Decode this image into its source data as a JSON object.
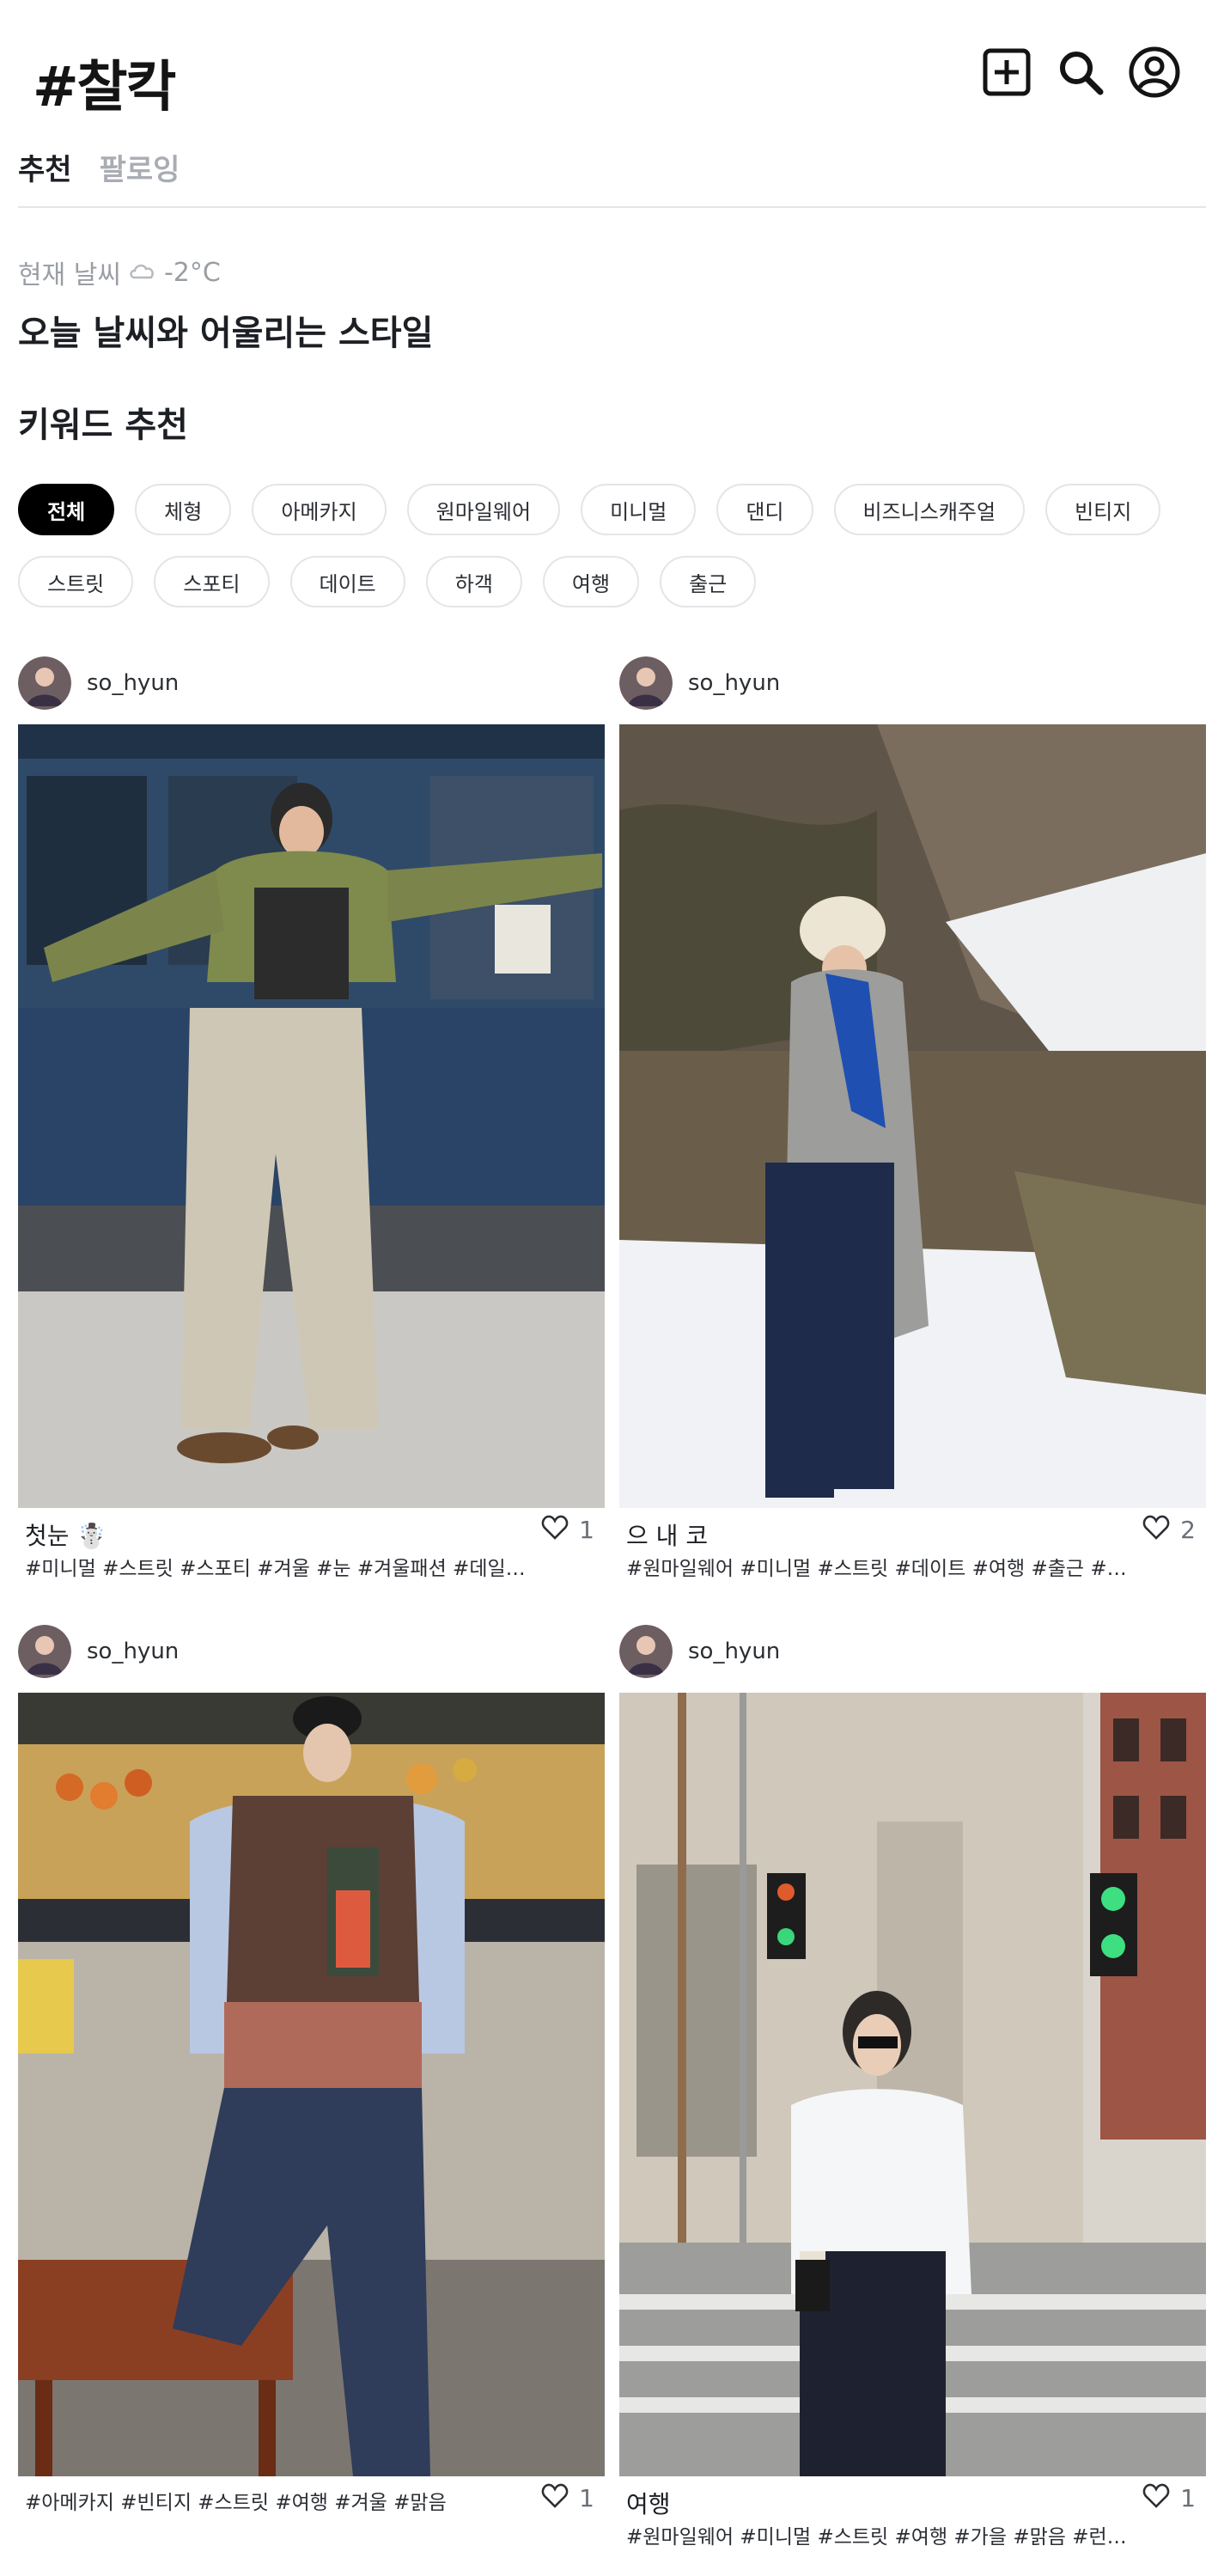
{
  "app": {
    "logo": "#찰칵"
  },
  "header": {
    "icons": [
      "add-square-icon",
      "search-icon",
      "profile-icon"
    ]
  },
  "tabs": [
    {
      "label": "추천",
      "active": true
    },
    {
      "label": "팔로잉",
      "active": false
    }
  ],
  "weather": {
    "label": "현재 날씨",
    "icon": "cloud-icon",
    "temp": "-2°C",
    "headline": "오늘 날씨와 어울리는 스타일"
  },
  "keywords": {
    "title": "키워드 추천",
    "row1": [
      "전체",
      "체형",
      "아메카지",
      "원마일웨어",
      "미니멀",
      "댄디",
      "비즈니스캐주얼",
      "빈티지"
    ],
    "row2": [
      "스트릿",
      "스포티",
      "데이트",
      "하객",
      "여행",
      "출근"
    ],
    "active": "전체"
  },
  "posts": [
    {
      "username": "so_hyun",
      "title": "첫눈 ☃️",
      "tags": "#미니멀 #스트릿 #스포티 #겨울 #눈 #겨울패션 #데일리...",
      "likes": "1"
    },
    {
      "username": "so_hyun",
      "title": "으 내 코",
      "tags": "#원마일웨어 #미니멀 #스트릿 #데이트 #여행 #출근 #겨...",
      "likes": "2"
    },
    {
      "username": "so_hyun",
      "title": "",
      "tags": "#아메카지 #빈티지 #스트릿 #여행 #겨울 #맑음",
      "likes": "1"
    },
    {
      "username": "so_hyun",
      "title": "여행",
      "tags": "#원마일웨어 #미니멀 #스트릿 #여행 #가을 #맑음 #런던...",
      "likes": "1"
    }
  ],
  "colors": {
    "accent": "#000000",
    "chip_border": "#e3e5e8",
    "muted": "#9a9ea4"
  }
}
